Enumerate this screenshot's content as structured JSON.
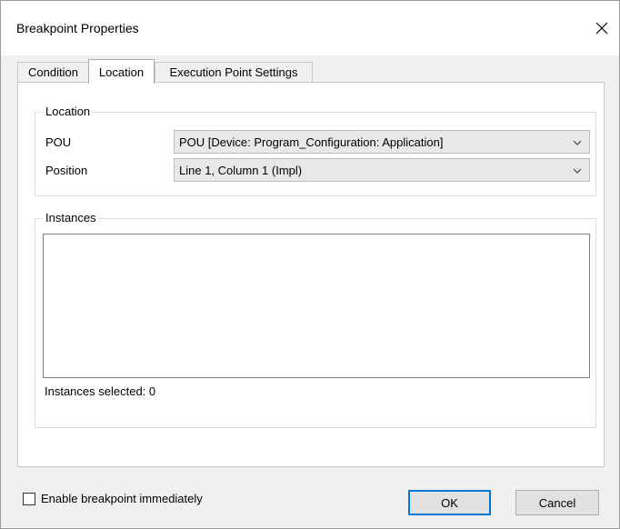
{
  "window": {
    "title": "Breakpoint Properties"
  },
  "tabs": [
    {
      "label": "Condition",
      "active": false
    },
    {
      "label": "Location",
      "active": true
    },
    {
      "label": "Execution Point Settings",
      "active": false
    }
  ],
  "location_group": {
    "title": "Location",
    "pou_label": "POU",
    "pou_value": "POU [Device: Program_Configuration: Application]",
    "position_label": "Position",
    "position_value": "Line 1, Column 1 (Impl)"
  },
  "instances_group": {
    "title": "Instances",
    "selected_text": "Instances selected: 0"
  },
  "footer": {
    "enable_label": "Enable breakpoint immediately",
    "enable_checked": false,
    "ok_label": "OK",
    "cancel_label": "Cancel"
  },
  "icons": {
    "close": "close-icon",
    "dropdown": "chevron-down-icon",
    "checkbox": "checkbox-unchecked"
  },
  "colors": {
    "default_button_border": "#0078d7",
    "dialog_background": "#f0f0f0"
  }
}
